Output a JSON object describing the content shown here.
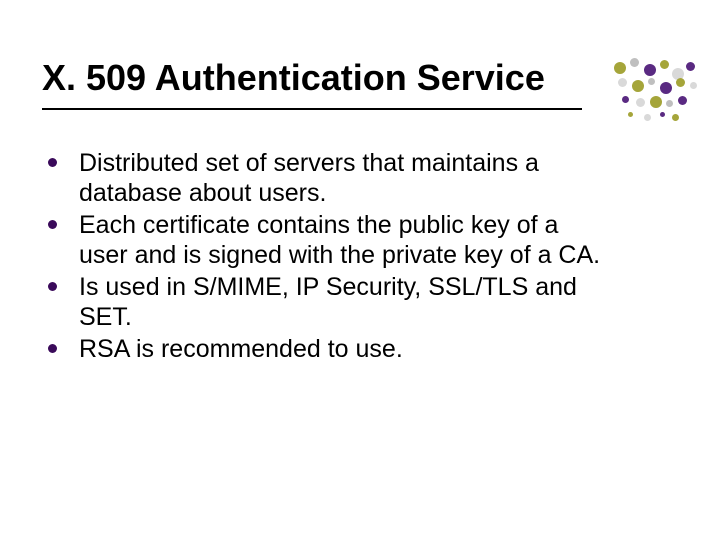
{
  "title": "X. 509 Authentication Service",
  "bullets": [
    "Distributed set of servers that maintains a database about users.",
    "Each certificate contains the public key of a user and is signed with the private key of a CA.",
    "Is used in S/MIME, IP Security, SSL/TLS and SET.",
    "RSA is recommended to use."
  ]
}
